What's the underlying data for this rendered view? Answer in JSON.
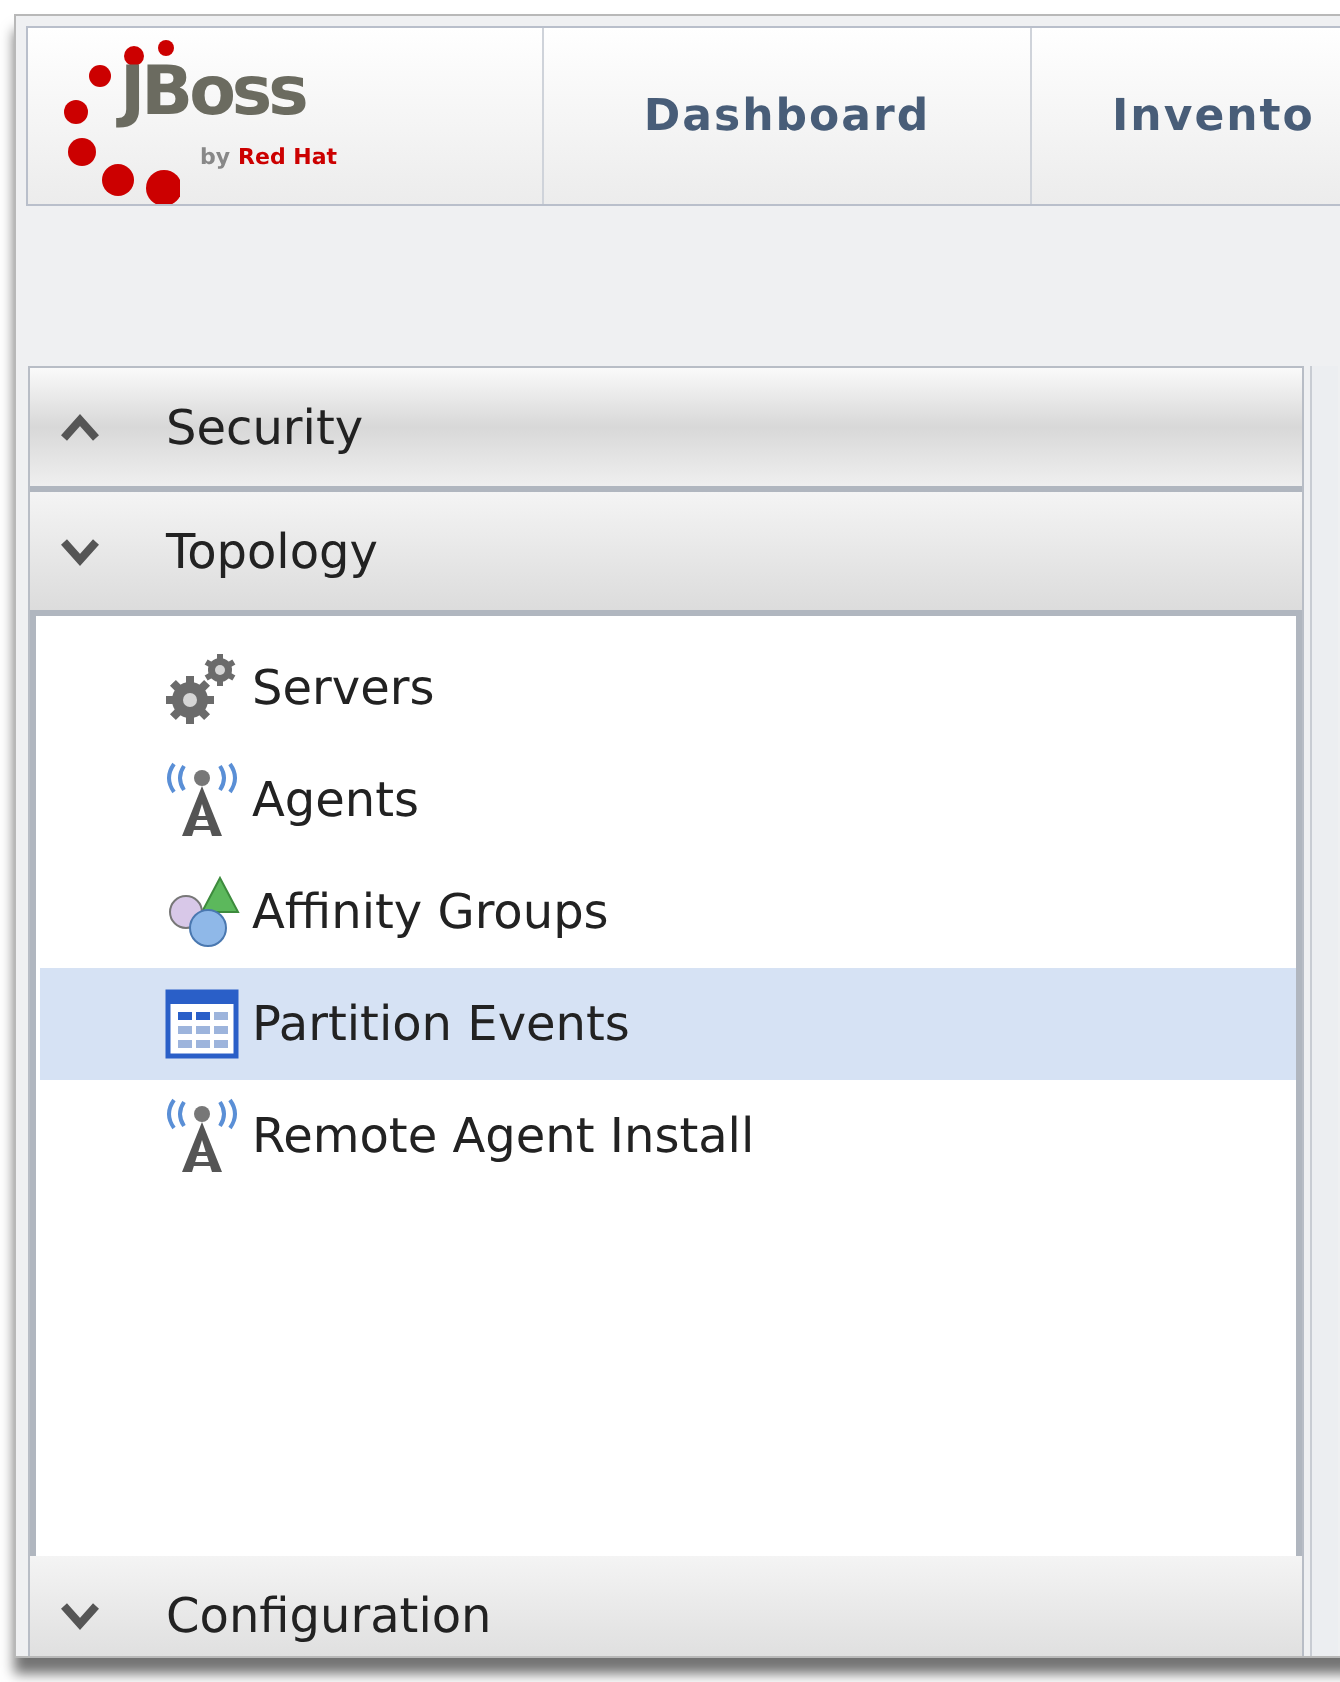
{
  "logo": {
    "name": "JBoss",
    "byline": "by",
    "brand": "Red Hat"
  },
  "nav_tabs": [
    {
      "label": "Dashboard",
      "selected": false
    },
    {
      "label": "Invento",
      "selected": false
    }
  ],
  "sections": [
    {
      "title": "Security",
      "expanded": false
    },
    {
      "title": "Topology",
      "expanded": true,
      "items": [
        {
          "label": "Servers",
          "kind": "gears",
          "selected": false
        },
        {
          "label": "Agents",
          "kind": "tower",
          "selected": false
        },
        {
          "label": "Affinity Groups",
          "kind": "shapes",
          "selected": false
        },
        {
          "label": "Partition Events",
          "kind": "calendar",
          "selected": true
        },
        {
          "label": "Remote Agent Install",
          "kind": "tower",
          "selected": false
        }
      ]
    },
    {
      "title": "Configuration",
      "expanded": true
    }
  ]
}
